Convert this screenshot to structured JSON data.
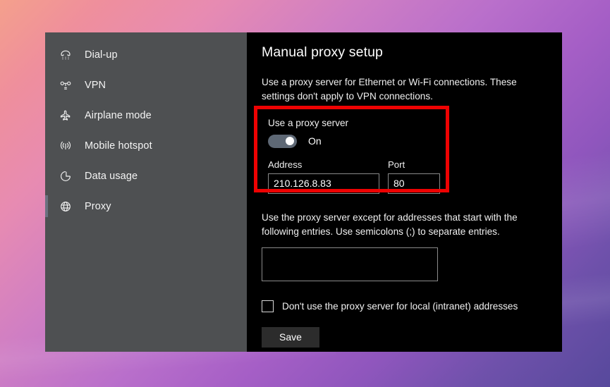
{
  "sidebar": {
    "items": [
      {
        "label": "Dial-up",
        "icon": "dialup-icon",
        "selected": false
      },
      {
        "label": "VPN",
        "icon": "vpn-icon",
        "selected": false
      },
      {
        "label": "Airplane mode",
        "icon": "airplane-icon",
        "selected": false
      },
      {
        "label": "Mobile hotspot",
        "icon": "hotspot-icon",
        "selected": false
      },
      {
        "label": "Data usage",
        "icon": "data-usage-icon",
        "selected": false
      },
      {
        "label": "Proxy",
        "icon": "globe-icon",
        "selected": true
      }
    ]
  },
  "content": {
    "title": "Manual proxy setup",
    "description": "Use a proxy server for Ethernet or Wi-Fi connections. These settings don't apply to VPN connections.",
    "use_proxy_label": "Use a proxy server",
    "toggle_state": "On",
    "toggle_on": true,
    "address_label": "Address",
    "address_value": "210.126.8.83",
    "port_label": "Port",
    "port_value": "80",
    "exceptions_description": "Use the proxy server except for addresses that start with the following entries. Use semicolons (;) to separate entries.",
    "exceptions_value": "",
    "local_bypass_label": "Don't use the proxy server for local (intranet) addresses",
    "local_bypass_checked": false,
    "save_label": "Save"
  },
  "colors": {
    "highlight": "#ee0202",
    "toggle_track": "#5e6875",
    "sidebar_bg": "#4e5052",
    "content_bg": "#000000",
    "selection_accent": "#6a7180"
  }
}
